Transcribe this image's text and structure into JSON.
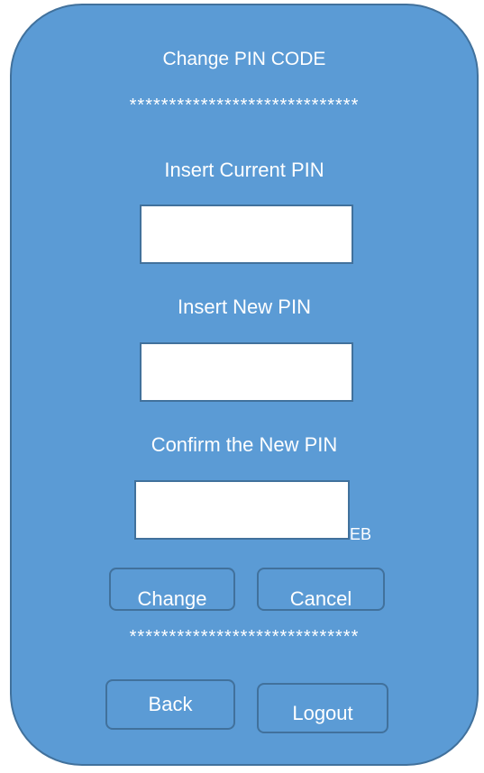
{
  "screen": {
    "title": "Change PIN CODE",
    "separator_top": "*****************************",
    "separator_bottom": "*****************************"
  },
  "form": {
    "current_pin": {
      "label": "Insert Current PIN",
      "value": ""
    },
    "new_pin": {
      "label": "Insert New PIN",
      "value": ""
    },
    "confirm_pin": {
      "label": "Confirm the New PIN",
      "value": "",
      "suffix": "EB"
    }
  },
  "actions": {
    "change_label": "Change",
    "cancel_label": "Cancel",
    "back_label": "Back",
    "logout_label": "Logout"
  },
  "colors": {
    "panel": "#5b9bd5",
    "border": "#41719c",
    "text": "#ffffff",
    "field": "#ffffff"
  }
}
